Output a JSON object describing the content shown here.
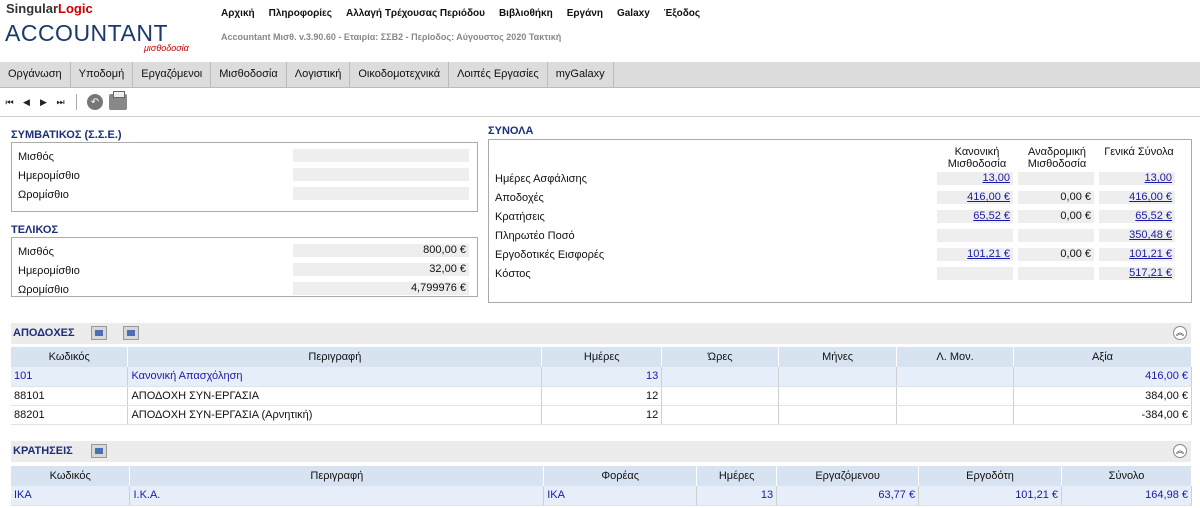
{
  "brand": {
    "top_a": "Singular",
    "top_b": "Logic",
    "main": "ACCOUNTANT",
    "sub": "μισθοδοσία"
  },
  "topnav": [
    "Αρχική",
    "Πληροφορίες",
    "Αλλαγή Τρέχουσας Περιόδου",
    "Βιβλιοθήκη",
    "Εργάνη",
    "Galaxy",
    "Έξοδος"
  ],
  "version": "Accountant Μισθ. v.3.90.60 - Εταιρία: ΣΣΒ2 - Περίοδος: Αύγουστος 2020 Τακτική",
  "menu": [
    "Οργάνωση",
    "Υποδομή",
    "Εργαζόμενοι",
    "Μισθοδοσία",
    "Λογιστική",
    "Οικοδομοτεχνικά",
    "Λοιπές Εργασίες",
    "myGalaxy"
  ],
  "toolbar": {
    "first": "⏮",
    "prev": "◀",
    "next": "▶",
    "last": "⏭"
  },
  "symvatikos": {
    "title": "ΣΥΜΒΑΤΙΚΟΣ (Σ.Σ.Ε.)",
    "rows": [
      {
        "label": "Μισθός",
        "value": ""
      },
      {
        "label": "Ημερομίσθιο",
        "value": ""
      },
      {
        "label": "Ωρομίσθιο",
        "value": ""
      }
    ]
  },
  "telikos": {
    "title": "ΤΕΛΙΚΟΣ",
    "rows": [
      {
        "label": "Μισθός",
        "value": "800,00 €"
      },
      {
        "label": "Ημερομίσθιο",
        "value": "32,00 €"
      },
      {
        "label": "Ωρομίσθιο",
        "value": "4,799976 €"
      }
    ]
  },
  "synola": {
    "title": "ΣΥΝΟΛΑ",
    "headers": [
      "Κανονική Μισθοδοσία",
      "Αναδρομική Μισθοδοσία",
      "Γενικά Σύνολα"
    ],
    "rows": [
      {
        "label": "Ημέρες Ασφάλισης",
        "c1": "13,00",
        "c2": "",
        "c3": "13,00"
      },
      {
        "label": "Αποδοχές",
        "c1": "416,00 €",
        "c2": "0,00 €",
        "c3": "416,00 €"
      },
      {
        "label": "Κρατήσεις",
        "c1": "65,52 €",
        "c2": "0,00 €",
        "c3": "65,52 €"
      },
      {
        "label": "Πληρωτέο Ποσό",
        "c1": "",
        "c2": "",
        "c3": "350,48 €"
      },
      {
        "label": "Εργοδοτικές Εισφορές",
        "c1": "101,21 €",
        "c2": "0,00 €",
        "c3": "101,21 €"
      },
      {
        "label": "Κόστος",
        "c1": "",
        "c2": "",
        "c3": "517,21 €"
      }
    ]
  },
  "apodoxes": {
    "title": "ΑΠΟΔΟΧΕΣ",
    "columns": [
      "Κωδικός",
      "Περιγραφή",
      "Ημέρες",
      "Ώρες",
      "Μήνες",
      "Λ. Μον.",
      "Αξία"
    ],
    "rows": [
      [
        "101",
        "Κανονική Απασχόληση",
        "13",
        "",
        "",
        "",
        "416,00 €"
      ],
      [
        "88101",
        "ΑΠΟΔΟΧΗ ΣΥΝ-ΕΡΓΑΣΙΑ",
        "12",
        "",
        "",
        "",
        "384,00 €"
      ],
      [
        "88201",
        "ΑΠΟΔΟΧΗ ΣΥΝ-ΕΡΓΑΣΙΑ (Αρνητική)",
        "12",
        "",
        "",
        "",
        "-384,00 €"
      ]
    ]
  },
  "kratiseis": {
    "title": "ΚΡΑΤΗΣΕΙΣ",
    "columns": [
      "Κωδικός",
      "Περιγραφή",
      "Φορέας",
      "Ημέρες",
      "Εργαζόμενου",
      "Εργοδότη",
      "Σύνολο"
    ],
    "rows": [
      [
        "ΙΚΑ",
        "Ι.Κ.Α.",
        "ΙΚΑ",
        "13",
        "63,77 €",
        "101,21 €",
        "164,98 €"
      ]
    ]
  }
}
